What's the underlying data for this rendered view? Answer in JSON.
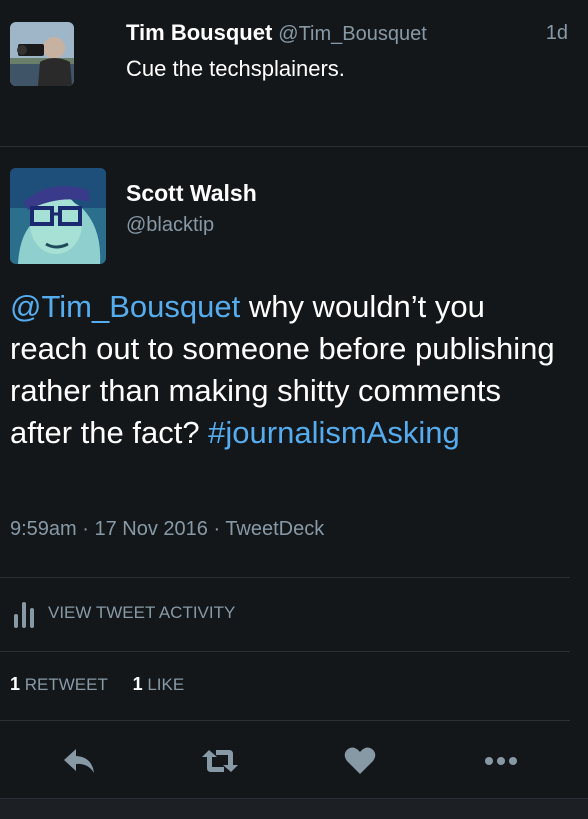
{
  "previous_tweet": {
    "name": "Tim Bousquet",
    "handle": "@Tim_Bousquet",
    "time": "1d",
    "text": "Cue the techsplainers."
  },
  "tweet": {
    "name": "Scott Walsh",
    "handle": "@blacktip",
    "mention": "@Tim_Bousquet",
    "text": " why wouldn’t you reach out to someone before publishing rather than making shitty comments after the fact? ",
    "hashtag": "#journalismAsking",
    "meta": "9:59am · 17 Nov 2016 · TweetDeck"
  },
  "activity_label": "VIEW TWEET ACTIVITY",
  "stats": {
    "retweets_count": "1",
    "retweets_label": "RETWEET",
    "likes_count": "1",
    "likes_label": "LIKE"
  },
  "icons": {
    "reply": "reply-icon",
    "retweet": "retweet-icon",
    "like": "heart-icon",
    "more": "more-icon",
    "activity": "bar-chart-icon"
  },
  "colors": {
    "background": "#14171a",
    "link": "#55acee",
    "muted": "#8899a6"
  }
}
